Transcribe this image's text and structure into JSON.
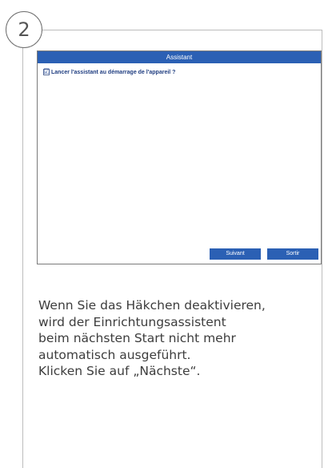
{
  "step": {
    "number": "2"
  },
  "dialog": {
    "title": "Assistant",
    "checkbox_label": "Lancer l'assistant au démarrage de l'appareil ?",
    "checkbox_checked": true,
    "checkbox_mark": "☑",
    "buttons": {
      "next_label": "Suivant",
      "exit_label": "Sortir"
    },
    "colors": {
      "titlebar": "#2b60b4",
      "buttons": "#2b60b4",
      "label_text": "#1f3d80"
    }
  },
  "instructions": {
    "text": "Wenn Sie das Häkchen deaktivieren,\nwird der Einrichtungsassistent\nbeim nächsten Start nicht mehr\nautomatisch ausgeführt.\nKlicken Sie auf „Nächste“."
  }
}
